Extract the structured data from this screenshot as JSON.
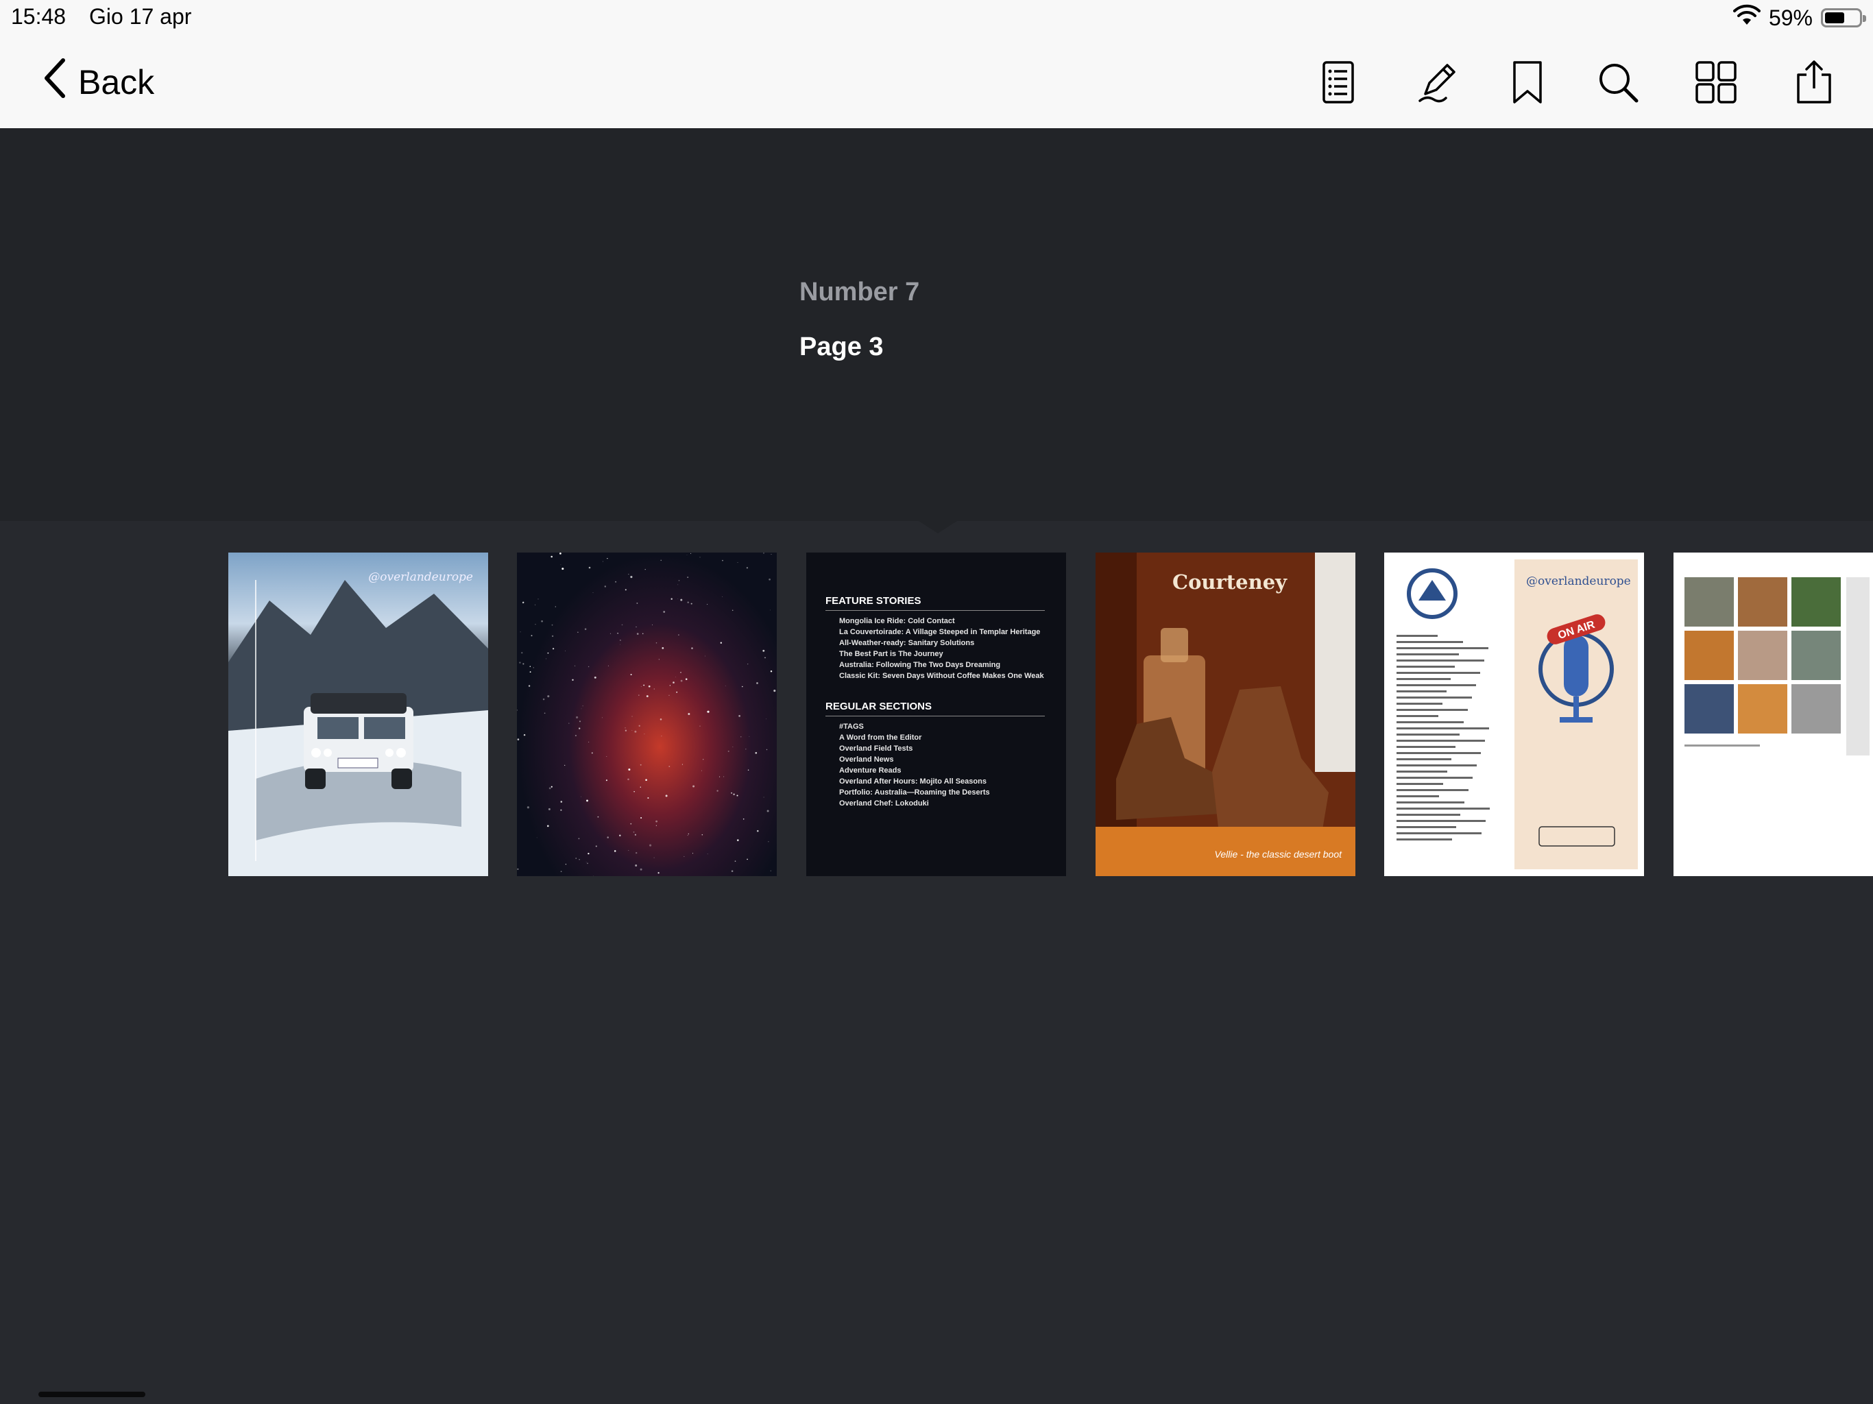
{
  "status_bar": {
    "time": "15:48",
    "date": "Gio 17 apr",
    "battery_text": "59%",
    "battery_level": 0.59
  },
  "toolbar": {
    "back_label": "Back",
    "tools": [
      "table-of-contents-icon",
      "markup-pencil-icon",
      "bookmark-icon",
      "search-icon",
      "thumbnail-grid-icon",
      "share-icon"
    ]
  },
  "document": {
    "title": "Number 7",
    "page_label": "Page 3"
  },
  "thumbnails": {
    "page1": {
      "brand": "@overlandeurope"
    },
    "page3": {
      "section1": "FEATURE STORIES",
      "items1": [
        "Mongolia Ice Ride: Cold Contact",
        "La Couvertoirade: A Village Steeped in Templar Heritage",
        "All-Weather-ready: Sanitary Solutions",
        "The Best Part is The Journey",
        "Australia: Following The Two Days Dreaming",
        "Classic Kit: Seven Days Without Coffee Makes One Weak"
      ],
      "section2": "REGULAR SECTIONS",
      "items2": [
        "#TAGS",
        "A Word from the Editor",
        "Overland Field Tests",
        "Overland News",
        "Adventure Reads",
        "Overland After Hours: Mojito All Seasons",
        "Portfolio: Australia—Roaming the Deserts",
        "Overland Chef: Lokoduki"
      ]
    },
    "page4": {
      "brand": "Courteney",
      "caption": "Vellie - the classic desert boot"
    },
    "page5": {
      "brand": "@overlandeurope",
      "badge": "ON AIR"
    }
  },
  "colors": {
    "background": "#27292e",
    "header_background": "#222428",
    "toolbar_background": "#f8f8f8"
  }
}
